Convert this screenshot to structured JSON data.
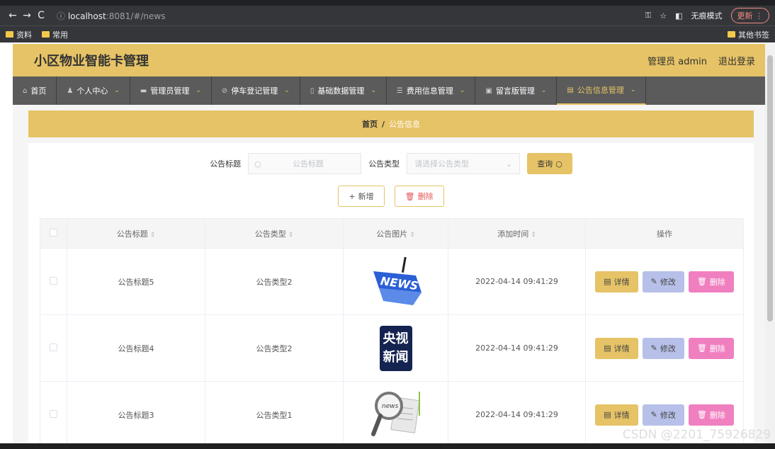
{
  "browser": {
    "url_host": "localhost",
    "url_rest": ":8081/#/news",
    "incognito_label": "无痕模式",
    "update_label": "更新",
    "bookmarks": [
      "资料",
      "常用"
    ],
    "other_bookmarks": "其他书签"
  },
  "header": {
    "title": "小区物业智能卡管理",
    "user": "管理员 admin",
    "logout": "退出登录"
  },
  "menu": [
    {
      "label": "首页",
      "icon": "home-icon"
    },
    {
      "label": "个人中心",
      "icon": "user-icon"
    },
    {
      "label": "管理员管理",
      "icon": "list-icon"
    },
    {
      "label": "停车登记管理",
      "icon": "car-icon"
    },
    {
      "label": "基础数据管理",
      "icon": "data-icon"
    },
    {
      "label": "费用信息管理",
      "icon": "fee-icon"
    },
    {
      "label": "留言版管理",
      "icon": "message-icon"
    },
    {
      "label": "公告信息管理",
      "icon": "notice-icon"
    }
  ],
  "breadcrumb": {
    "home": "首页",
    "sep": "/",
    "current": "公告信息"
  },
  "search": {
    "title_label": "公告标题",
    "title_placeholder": "公告标题",
    "type_label": "公告类型",
    "type_placeholder": "请选择公告类型",
    "query": "查询"
  },
  "actions": {
    "add": "新增",
    "delete": "删除"
  },
  "table": {
    "headers": [
      "公告标题",
      "公告类型",
      "公告图片",
      "添加时间",
      "操作"
    ],
    "rows": [
      {
        "title": "公告标题5",
        "type": "公告类型2",
        "image": "news-keyboard",
        "time": "2022-04-14 09:41:29"
      },
      {
        "title": "公告标题4",
        "type": "公告类型2",
        "image": "cctv-news",
        "time": "2022-04-14 09:41:29"
      },
      {
        "title": "公告标题3",
        "type": "公告类型1",
        "image": "news-magnifier",
        "time": "2022-04-14 09:41:29"
      }
    ],
    "ops": {
      "detail": "详情",
      "edit": "修改",
      "delete": "删除"
    }
  },
  "thumbs": {
    "cctv_line1": "央视",
    "cctv_line2": "新闻",
    "news_key": "NEWS",
    "news_paper": "news"
  },
  "watermark": "CSDN @2201_75926829"
}
